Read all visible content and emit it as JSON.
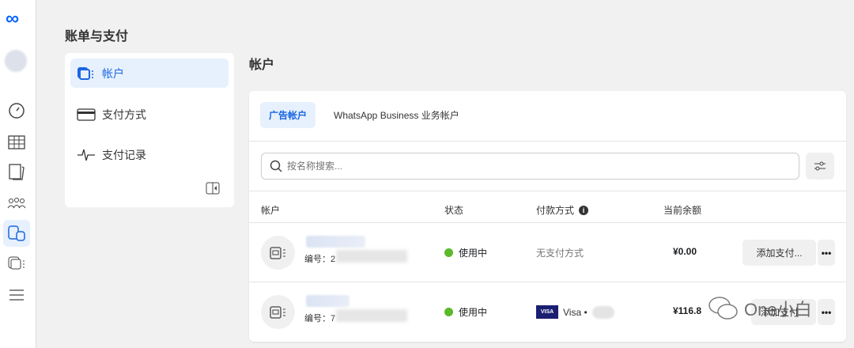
{
  "page": {
    "title": "账单与支付",
    "section_title": "帐户"
  },
  "left_nav": {
    "items": [
      {
        "label": "帐户"
      },
      {
        "label": "支付方式"
      },
      {
        "label": "支付记录"
      }
    ]
  },
  "tabs": [
    {
      "label": "广告帐户"
    },
    {
      "label": "WhatsApp Business 业务帐户"
    }
  ],
  "search": {
    "placeholder": "按名称搜索..."
  },
  "table": {
    "headers": [
      "帐户",
      "状态",
      "付款方式",
      "当前余额"
    ],
    "rows": [
      {
        "id_label": "编号：2",
        "status": "使用中",
        "payment": "无支付方式",
        "balance": "¥0.00",
        "action": "添加支付..."
      },
      {
        "id_label": "编号：7",
        "status": "使用中",
        "payment": "Visa •",
        "balance": "¥116.8",
        "action": "添加支付..."
      }
    ]
  },
  "more_label": "•••",
  "visa_badge": "VISA",
  "watermark": "One小白",
  "colors": {
    "accent": "#1a66e0",
    "active_bg": "#e7f0fd",
    "status_green": "#5ab92c"
  }
}
